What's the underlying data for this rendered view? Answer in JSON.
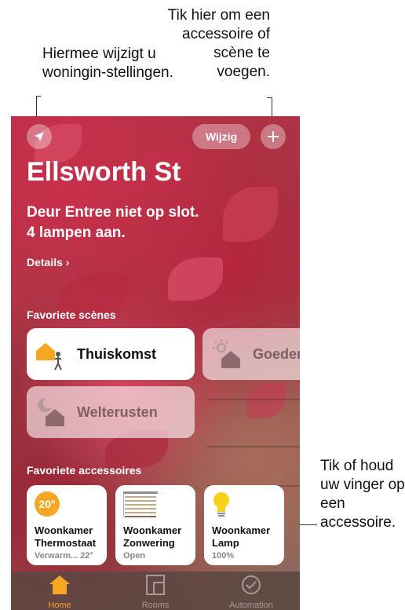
{
  "callouts": {
    "left": "Hiermee wijzigt u woningin-stellingen.",
    "right": "Tik hier om een accessoire of scène te voegen.",
    "accessory": "Tik of houd uw vinger op een accessoire."
  },
  "header": {
    "location_icon": "location-arrow-icon",
    "edit_label": "Wijzig",
    "add_icon": "plus-icon"
  },
  "home": {
    "title": "Ellsworth St",
    "status_line1": "Deur Entree niet op slot.",
    "status_line2": "4 lampen aan.",
    "details": "Details ›"
  },
  "scenes": {
    "title": "Favoriete scènes",
    "items": [
      {
        "label": "Thuiskomst",
        "icon": "arriving-home-icon",
        "active": true
      },
      {
        "label": "Goeden",
        "icon": "good-morning-icon",
        "active": false
      },
      {
        "label": "Welterusten",
        "icon": "good-night-icon",
        "active": false
      }
    ]
  },
  "accessories": {
    "title": "Favoriete accessoires",
    "items": [
      {
        "name_line1": "Woonkamer",
        "name_line2": "Thermostaat",
        "state": "Verwarm... 22°",
        "badge": "20°",
        "icon": "thermostat-icon"
      },
      {
        "name_line1": "Woonkamer",
        "name_line2": "Zonwering",
        "state": "Open",
        "icon": "blinds-icon"
      },
      {
        "name_line1": "Woonkamer",
        "name_line2": "Lamp",
        "state": "100%",
        "icon": "lightbulb-icon"
      }
    ]
  },
  "tabbar": {
    "tabs": [
      {
        "label": "Home",
        "icon": "home-icon",
        "selected": true
      },
      {
        "label": "Rooms",
        "icon": "rooms-icon",
        "selected": false
      },
      {
        "label": "Automation",
        "icon": "automation-icon",
        "selected": false
      }
    ]
  },
  "colors": {
    "accent": "#f5a623",
    "bulb": "#f7d21b"
  }
}
